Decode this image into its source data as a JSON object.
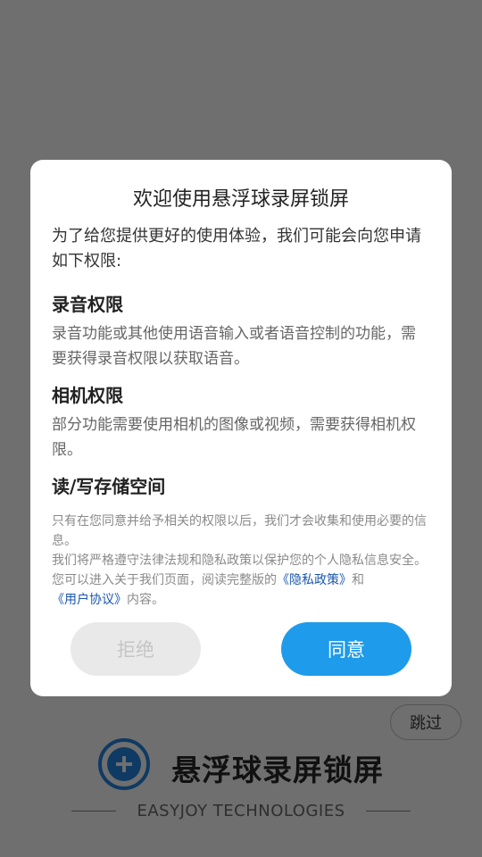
{
  "background": {
    "skip_label": "跳过",
    "brand_name": "悬浮球录屏锁屏",
    "brand_subtitle": "EASYJOY TECHNOLOGIES",
    "brand_icon": "plus-circle-icon"
  },
  "dialog": {
    "title": "欢迎使用悬浮球录屏锁屏",
    "intro": "为了给您提供更好的使用体验，我们可能会向您申请如下权限:",
    "sections": [
      {
        "title": "录音权限",
        "desc": "录音功能或其他使用语音输入或者语音控制的功能，需要获得录音权限以获取语音。"
      },
      {
        "title": "相机权限",
        "desc": "部分功能需要使用相机的图像或视频，需要获得相机权限。"
      },
      {
        "title": "读/写存储空间",
        "desc": ""
      }
    ],
    "notice_line1": "只有在您同意并给予相关的权限以后，我们才会收集和使用必要的信息。",
    "notice_line2_text": "我们将严格遵守法律法规和隐私政策以保护您的个人隐私信息安全。您可以进入关于我们页面，阅读完整版的",
    "privacy_link": "《隐私政策》",
    "and_text": "和",
    "user_agreement_link": "《用户协议》",
    "tail_text": "内容。",
    "reject_label": "拒绝",
    "agree_label": "同意"
  },
  "colors": {
    "overlay": "#6f6f6f",
    "accent": "#1e9bea",
    "link": "#1a56b0"
  }
}
